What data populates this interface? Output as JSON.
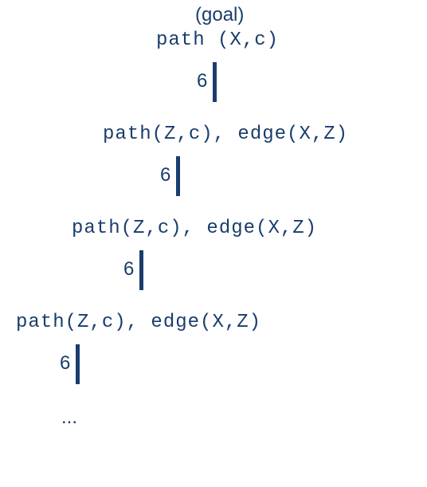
{
  "title": "(goal)",
  "nodes": [
    {
      "text": "path (X,c)"
    },
    {
      "text": "path(Z,c), edge(X,Z)"
    },
    {
      "text": "path(Z,c), edge(X,Z)"
    },
    {
      "text": "path(Z,c), edge(X,Z)"
    }
  ],
  "edges": [
    {
      "label": "6"
    },
    {
      "label": "6"
    },
    {
      "label": "6"
    },
    {
      "label": "6"
    }
  ],
  "ellipsis": "..."
}
